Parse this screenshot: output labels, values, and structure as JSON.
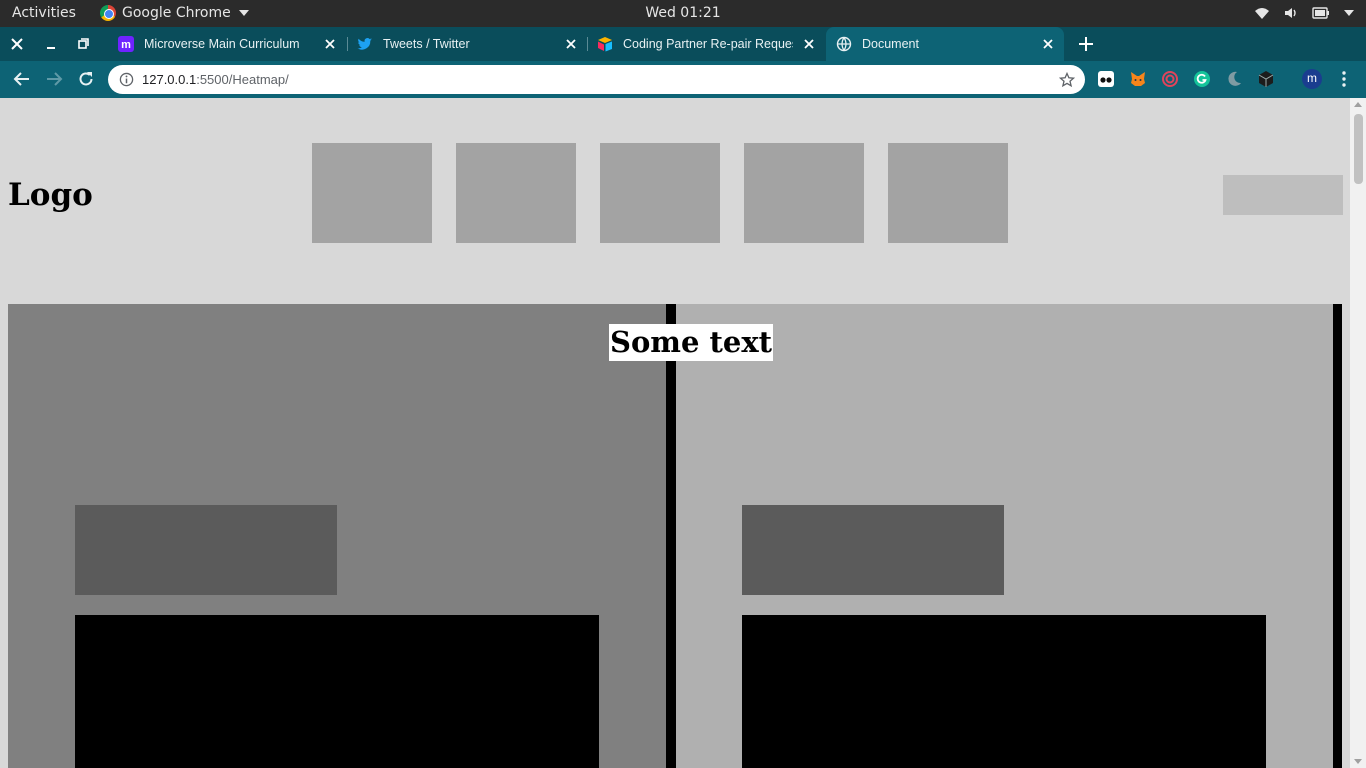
{
  "system_bar": {
    "activities": "Activities",
    "app_name": "Google Chrome",
    "clock": "Wed 01:21",
    "tray_icons": [
      "wifi-icon",
      "volume-icon",
      "battery-icon",
      "system-menu-caret-icon"
    ]
  },
  "browser": {
    "tabs": [
      {
        "title": "Microverse Main Curriculum",
        "favicon": "microverse-icon",
        "active": false
      },
      {
        "title": "Tweets / Twitter",
        "favicon": "twitter-icon",
        "active": false
      },
      {
        "title": "Coding Partner Re-pair Request",
        "favicon": "airtable-icon",
        "active": false
      },
      {
        "title": "Document",
        "favicon": "globe-icon",
        "active": true
      }
    ],
    "url_host": "127.0.0.1",
    "url_rest": ":5500/Heatmap/",
    "profile_initial": "m",
    "extensions": [
      "glasses-extension-icon",
      "metamask-extension-icon",
      "spiral-extension-icon",
      "grammarly-extension-icon",
      "moon-extension-icon",
      "cube-extension-icon"
    ],
    "colors": {
      "tab_strip": "#0a4d5b",
      "toolbar": "#0d6375"
    }
  },
  "page": {
    "logo": "Logo",
    "hero_text": "Some text",
    "nav_placeholder_count": 5,
    "colors": {
      "background": "#d8d8d8",
      "nav_box": "#a3a3a3",
      "left_panel": "#808080",
      "right_panel": "#b0b0b0",
      "inner_box": "#5b5b5b",
      "dark_box": "#000000"
    }
  }
}
